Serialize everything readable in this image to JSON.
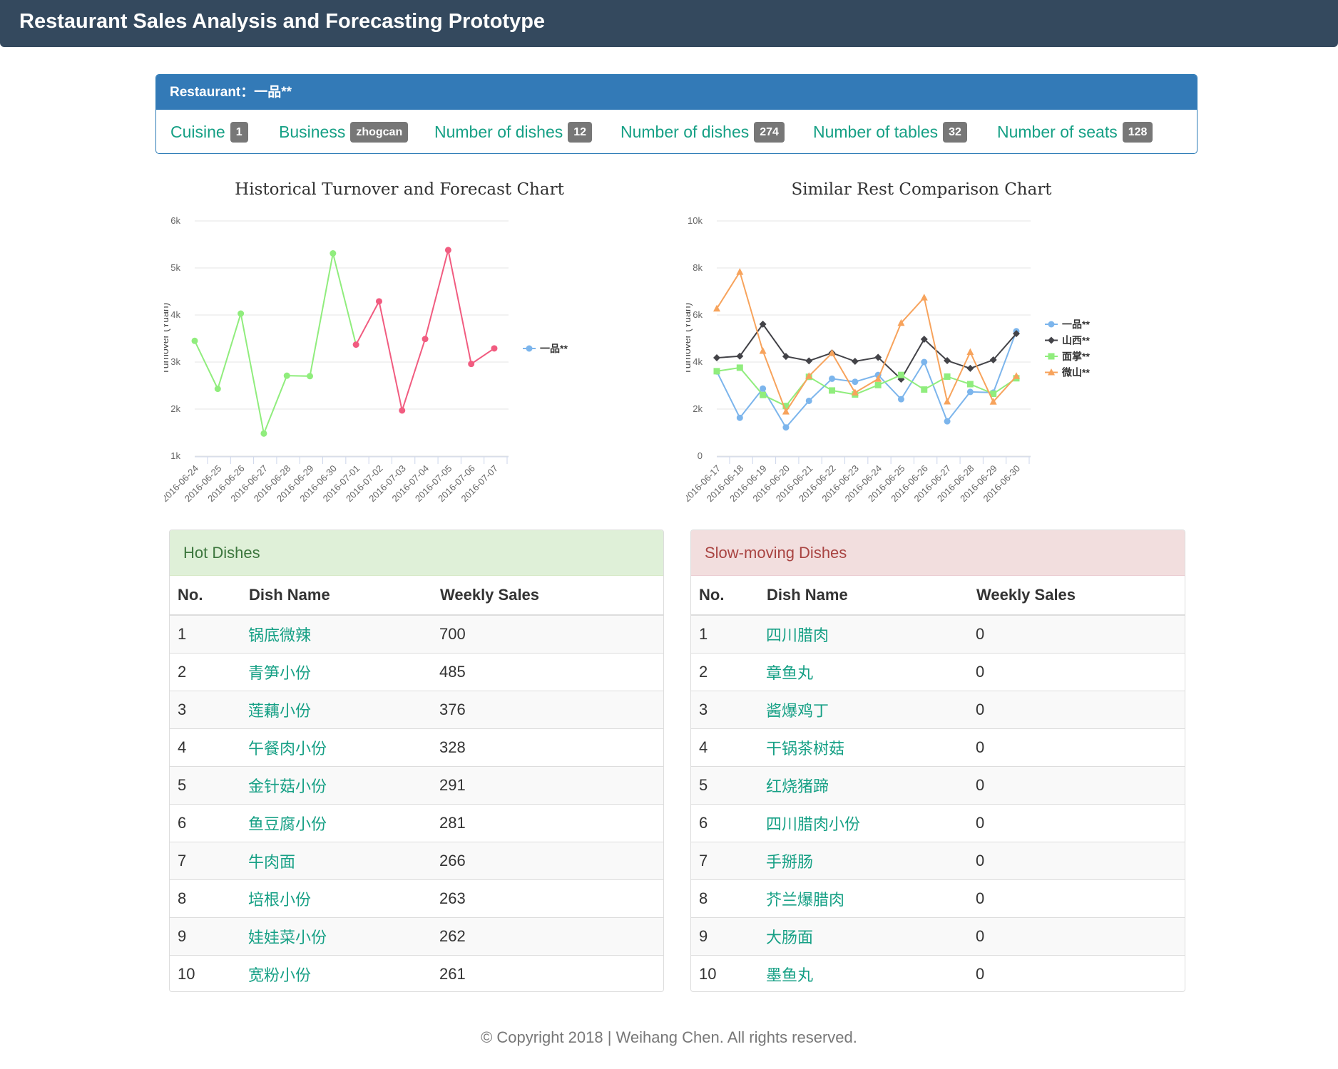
{
  "header": {
    "title": "Restaurant Sales Analysis and Forecasting Prototype"
  },
  "restaurant": {
    "label": "Restaurant：",
    "name": "一品**",
    "stats": [
      {
        "label": "Cuisine",
        "value": "1"
      },
      {
        "label": "Business",
        "value": "zhogcan"
      },
      {
        "label": "Number of dishes",
        "value": "12"
      },
      {
        "label": "Number of dishes",
        "value": "274"
      },
      {
        "label": "Number of tables",
        "value": "32"
      },
      {
        "label": "Number of seats",
        "value": "128"
      }
    ]
  },
  "chart_data": [
    {
      "type": "line",
      "title": "Historical Turnover and Forecast Chart",
      "xlabel": "",
      "ylabel": "Turnover (Yuan)",
      "ylim": [
        1000,
        6000
      ],
      "yticks": [
        "1k",
        "2k",
        "3k",
        "4k",
        "5k",
        "6k"
      ],
      "categories": [
        "2016-06-24",
        "2016-06-25",
        "2016-06-26",
        "2016-06-27",
        "2016-06-28",
        "2016-06-29",
        "2016-06-30",
        "2016-07-01",
        "2016-07-02",
        "2016-07-03",
        "2016-07-04",
        "2016-07-05",
        "2016-07-06",
        "2016-07-07"
      ],
      "series": [
        {
          "name": "一品**",
          "values": [
            3450,
            2430,
            4030,
            1480,
            2710,
            2700,
            5310,
            3370,
            4290,
            1970,
            3490,
            5380,
            2960,
            3290
          ]
        }
      ],
      "historical_color": "#90ed7d",
      "forecast_color": "#f15c80",
      "legend_color": "#7cb5ec",
      "forecast_start_index": 7,
      "legend": "right",
      "grid": true
    },
    {
      "type": "line",
      "title": "Similar Rest Comparison Chart",
      "xlabel": "",
      "ylabel": "Turnover (Yuan)",
      "ylim": [
        0,
        10000
      ],
      "yticks": [
        "0",
        "2k",
        "4k",
        "6k",
        "8k",
        "10k"
      ],
      "categories": [
        "2016-06-17",
        "2016-06-18",
        "2016-06-19",
        "2016-06-20",
        "2016-06-21",
        "2016-06-22",
        "2016-06-23",
        "2016-06-24",
        "2016-06-25",
        "2016-06-26",
        "2016-06-27",
        "2016-06-28",
        "2016-06-29",
        "2016-06-30"
      ],
      "series": [
        {
          "name": "一品**",
          "color": "#7cb5ec",
          "marker": "circle",
          "values": [
            3600,
            1630,
            2870,
            1220,
            2350,
            3290,
            3160,
            3450,
            2420,
            4000,
            1480,
            2730,
            2700,
            5310
          ]
        },
        {
          "name": "山西**",
          "color": "#434348",
          "marker": "diamond",
          "values": [
            4180,
            4250,
            5610,
            4240,
            4050,
            4390,
            4030,
            4200,
            3270,
            4970,
            4060,
            3730,
            4090,
            5210
          ]
        },
        {
          "name": "面掌**",
          "color": "#90ed7d",
          "marker": "square",
          "values": [
            3610,
            3760,
            2600,
            2130,
            3370,
            2790,
            2620,
            3020,
            3450,
            2830,
            3380,
            3060,
            2650,
            3310
          ]
        },
        {
          "name": "微山**",
          "color": "#f7a35c",
          "marker": "triangle",
          "values": [
            6270,
            7830,
            4470,
            1890,
            3400,
            4380,
            2700,
            3280,
            5660,
            6740,
            2320,
            4420,
            2310,
            3400
          ]
        }
      ],
      "legend": "right",
      "grid": true
    }
  ],
  "hot_dishes": {
    "title": "Hot Dishes",
    "headers": [
      "No.",
      "Dish Name",
      "Weekly Sales"
    ],
    "rows": [
      [
        "1",
        "锅底微辣",
        "700"
      ],
      [
        "2",
        "青笋小份",
        "485"
      ],
      [
        "3",
        "莲藕小份",
        "376"
      ],
      [
        "4",
        "午餐肉小份",
        "328"
      ],
      [
        "5",
        "金针菇小份",
        "291"
      ],
      [
        "6",
        "鱼豆腐小份",
        "281"
      ],
      [
        "7",
        "牛肉面",
        "266"
      ],
      [
        "8",
        "培根小份",
        "263"
      ],
      [
        "9",
        "娃娃菜小份",
        "262"
      ],
      [
        "10",
        "宽粉小份",
        "261"
      ]
    ]
  },
  "slow_dishes": {
    "title": "Slow-moving Dishes",
    "headers": [
      "No.",
      "Dish Name",
      "Weekly Sales"
    ],
    "rows": [
      [
        "1",
        "四川腊肉",
        "0"
      ],
      [
        "2",
        "章鱼丸",
        "0"
      ],
      [
        "3",
        "酱爆鸡丁",
        "0"
      ],
      [
        "4",
        "干锅茶树菇",
        "0"
      ],
      [
        "5",
        "红烧猪蹄",
        "0"
      ],
      [
        "6",
        "四川腊肉小份",
        "0"
      ],
      [
        "7",
        "手掰肠",
        "0"
      ],
      [
        "8",
        "芥兰爆腊肉",
        "0"
      ],
      [
        "9",
        "大肠面",
        "0"
      ],
      [
        "10",
        "墨鱼丸",
        "0"
      ]
    ]
  },
  "footer": {
    "text": "© Copyright 2018  |  Weihang Chen. All rights reserved."
  }
}
